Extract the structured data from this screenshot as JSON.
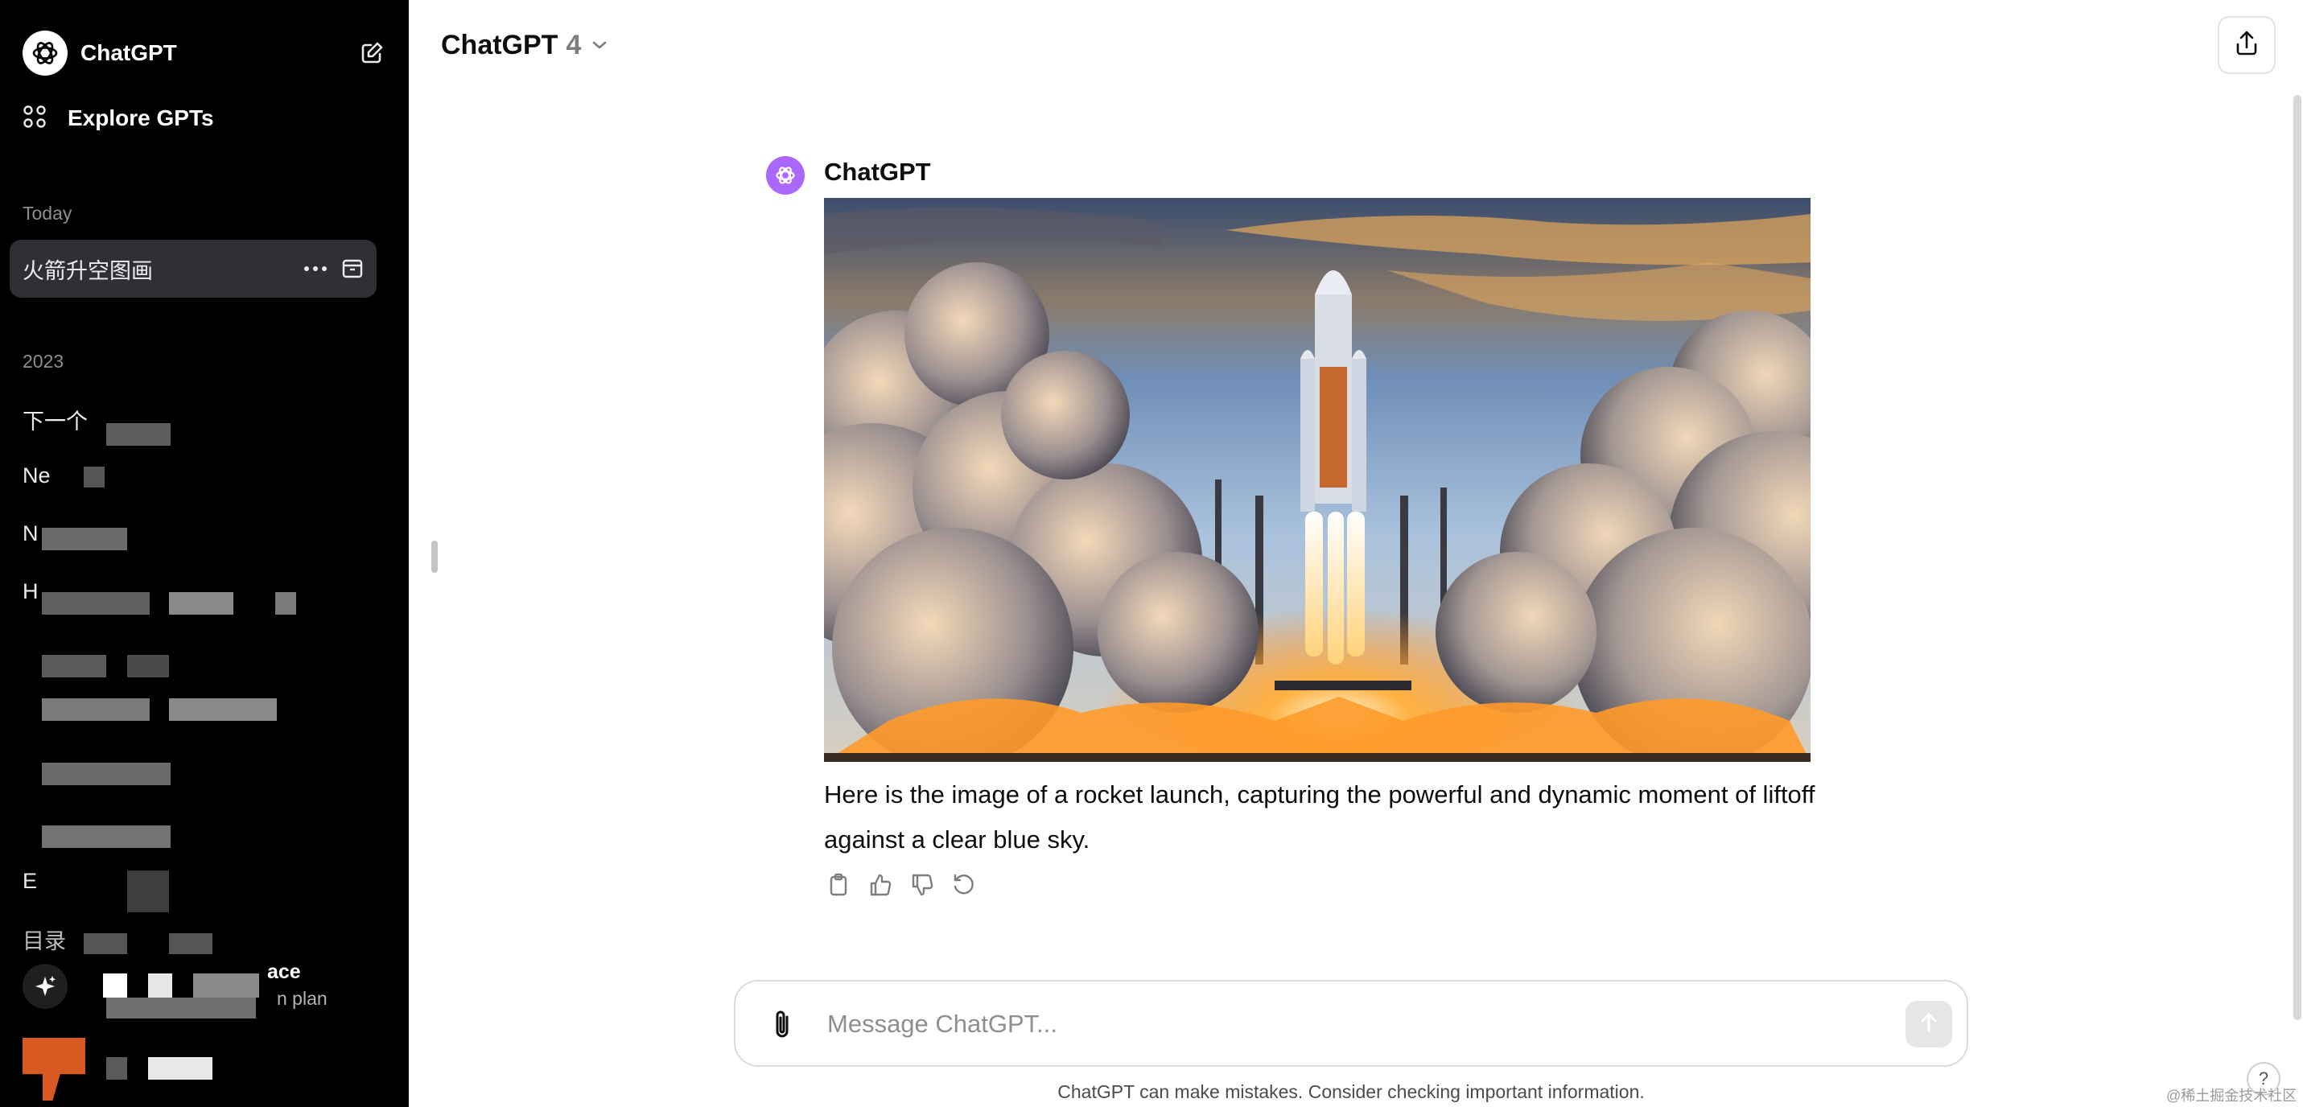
{
  "sidebar": {
    "brand": "ChatGPT",
    "explore_label": "Explore GPTs",
    "today_label": "Today",
    "active_chat": "火箭升空图画",
    "year_label": "2023",
    "history": [
      {
        "label": "下一个"
      },
      {
        "label": "Ne"
      },
      {
        "label": "N"
      },
      {
        "label": "H"
      },
      {
        "label": ""
      },
      {
        "label": ""
      },
      {
        "label": ""
      },
      {
        "label": ""
      },
      {
        "label": "E"
      },
      {
        "label": "目录"
      }
    ],
    "upgrade_title": "ace",
    "upgrade_sub": "n plan"
  },
  "header": {
    "model_name": "ChatGPT",
    "model_version": "4"
  },
  "message": {
    "author": "ChatGPT",
    "text": "Here is the image of a rocket launch, capturing the powerful and dynamic moment of liftoff against a clear blue sky."
  },
  "composer": {
    "placeholder": "Message ChatGPT..."
  },
  "footer": {
    "disclaimer": "ChatGPT can make mistakes. Consider checking important information.",
    "help": "?",
    "watermark": "@稀土掘金技术社区"
  },
  "colors": {
    "sidebar_bg": "#000000",
    "active_chat_bg": "#2f2f36",
    "assistant_avatar": "#ab68ff",
    "user_avatar": "#d85a22"
  },
  "icons": [
    "chatgpt-logo-icon",
    "new-chat-icon",
    "grid-icon",
    "more-icon",
    "archive-icon",
    "sparkle-icon",
    "chevron-down-icon",
    "share-icon",
    "copy-icon",
    "thumbs-up-icon",
    "thumbs-down-icon",
    "regenerate-icon",
    "paperclip-icon",
    "arrow-up-icon"
  ]
}
